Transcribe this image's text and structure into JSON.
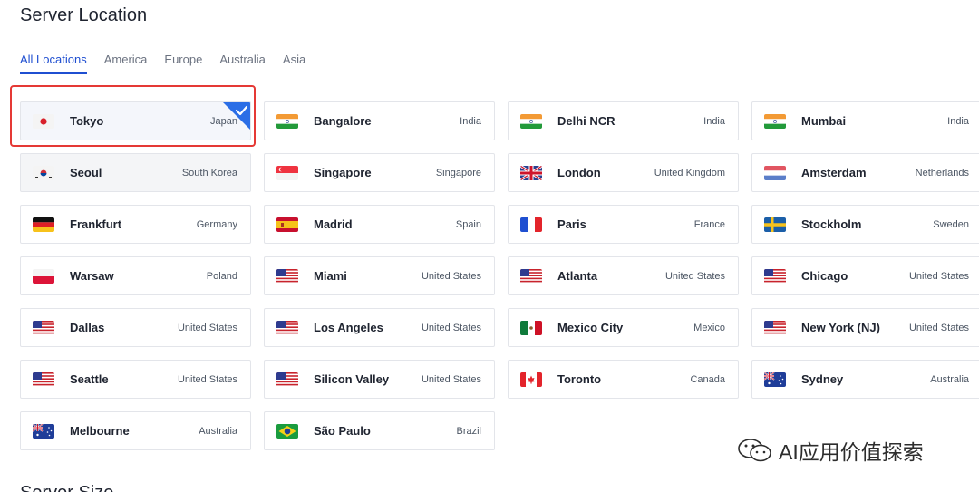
{
  "page_title": "Server Location",
  "tabs": [
    {
      "label": "All Locations",
      "active": true
    },
    {
      "label": "America",
      "active": false
    },
    {
      "label": "Europe",
      "active": false
    },
    {
      "label": "Australia",
      "active": false
    },
    {
      "label": "Asia",
      "active": false
    }
  ],
  "locations": [
    {
      "city": "Tokyo",
      "country": "Japan",
      "flag": "jp",
      "selected": true
    },
    {
      "city": "Bangalore",
      "country": "India",
      "flag": "in"
    },
    {
      "city": "Delhi NCR",
      "country": "India",
      "flag": "in"
    },
    {
      "city": "Mumbai",
      "country": "India",
      "flag": "in"
    },
    {
      "city": "Seoul",
      "country": "South Korea",
      "flag": "kr"
    },
    {
      "city": "Singapore",
      "country": "Singapore",
      "flag": "sg"
    },
    {
      "city": "London",
      "country": "United Kingdom",
      "flag": "gb"
    },
    {
      "city": "Amsterdam",
      "country": "Netherlands",
      "flag": "nl"
    },
    {
      "city": "Frankfurt",
      "country": "Germany",
      "flag": "de"
    },
    {
      "city": "Madrid",
      "country": "Spain",
      "flag": "es"
    },
    {
      "city": "Paris",
      "country": "France",
      "flag": "fr"
    },
    {
      "city": "Stockholm",
      "country": "Sweden",
      "flag": "se"
    },
    {
      "city": "Warsaw",
      "country": "Poland",
      "flag": "pl"
    },
    {
      "city": "Miami",
      "country": "United States",
      "flag": "us"
    },
    {
      "city": "Atlanta",
      "country": "United States",
      "flag": "us"
    },
    {
      "city": "Chicago",
      "country": "United States",
      "flag": "us"
    },
    {
      "city": "Dallas",
      "country": "United States",
      "flag": "us"
    },
    {
      "city": "Los Angeles",
      "country": "United States",
      "flag": "us"
    },
    {
      "city": "Mexico City",
      "country": "Mexico",
      "flag": "mx"
    },
    {
      "city": "New York (NJ)",
      "country": "United States",
      "flag": "us"
    },
    {
      "city": "Seattle",
      "country": "United States",
      "flag": "us"
    },
    {
      "city": "Silicon Valley",
      "country": "United States",
      "flag": "us"
    },
    {
      "city": "Toronto",
      "country": "Canada",
      "flag": "ca"
    },
    {
      "city": "Sydney",
      "country": "Australia",
      "flag": "au"
    },
    {
      "city": "Melbourne",
      "country": "Australia",
      "flag": "au"
    },
    {
      "city": "São Paulo",
      "country": "Brazil",
      "flag": "br"
    }
  ],
  "watermark_text": "AI应用价值探索",
  "next_heading": "Server Size",
  "colors": {
    "accent": "#1f4fd1",
    "check_badge": "#2b6ee6",
    "selection_outline": "#e53935"
  }
}
